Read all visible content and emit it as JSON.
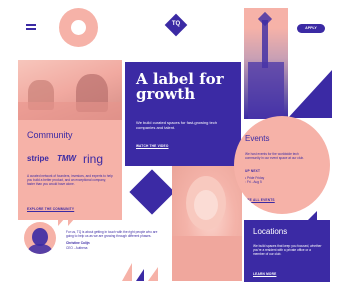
{
  "header": {
    "logo_text": "TQ",
    "cta_label": "APPLY",
    "menu_icon": "hamburger-menu-icon"
  },
  "hero": {
    "title_line1": "A label for",
    "title_line2": "growth",
    "subtitle": "We build curated spaces for fast-growing tech companies and talent.",
    "link_label": "WATCH THE VIDEO"
  },
  "community": {
    "title": "Community",
    "logos": [
      "stripe",
      "TMW",
      "ring"
    ],
    "body": "A curated network of founders, investors, and experts to help you build a better product, and an exceptional company, faster than you would have alone.",
    "link_label": "EXPLORE THE COMMUNITY"
  },
  "events": {
    "title": "Events",
    "body": "We host events for the worldwide tech community in our event space at our club.",
    "section_label": "UP NEXT",
    "items": [
      "Pride Friday",
      "Fri - Aug 5"
    ],
    "link_label": "SEE ALL EVENTS"
  },
  "quote": {
    "text": "For us, TQ is about getting in touch with the right people who are going to help us as we are growing through different phases.",
    "author": "Christine Colijn",
    "role": "CEO - Authena"
  },
  "locations": {
    "title": "Locations",
    "body": "We build spaces that keep you focused, whether you're a resident with a private office or a member of our club.",
    "link_label": "LEARN MORE"
  },
  "colors": {
    "navy": "#3b2aa4",
    "pink": "#f6b2a8",
    "white": "#ffffff"
  }
}
